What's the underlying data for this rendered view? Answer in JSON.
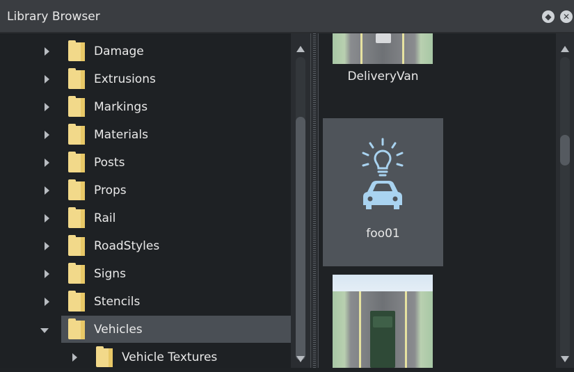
{
  "window": {
    "title": "Library Browser"
  },
  "tree": {
    "items": [
      {
        "label": "Damage",
        "expanded": false,
        "selected": false
      },
      {
        "label": "Extrusions",
        "expanded": false,
        "selected": false
      },
      {
        "label": "Markings",
        "expanded": false,
        "selected": false
      },
      {
        "label": "Materials",
        "expanded": false,
        "selected": false
      },
      {
        "label": "Posts",
        "expanded": false,
        "selected": false
      },
      {
        "label": "Props",
        "expanded": false,
        "selected": false
      },
      {
        "label": "Rail",
        "expanded": false,
        "selected": false
      },
      {
        "label": "RoadStyles",
        "expanded": false,
        "selected": false
      },
      {
        "label": "Signs",
        "expanded": false,
        "selected": false
      },
      {
        "label": "Stencils",
        "expanded": false,
        "selected": false
      },
      {
        "label": "Vehicles",
        "expanded": true,
        "selected": true
      },
      {
        "label": "Vehicle Textures",
        "expanded": false,
        "selected": false
      }
    ]
  },
  "tiles": [
    {
      "label": "DeliveryVan",
      "icon": "vehicle-thumbnail"
    },
    {
      "label": "foo01",
      "icon": "light-bulb-car-icon",
      "selected": true
    },
    {
      "label": "",
      "icon": "truck-thumbnail"
    }
  ],
  "colors": {
    "folder": "#f2d98a",
    "selection": "#4a4f55",
    "icon_blue": "#a9d3f0"
  }
}
